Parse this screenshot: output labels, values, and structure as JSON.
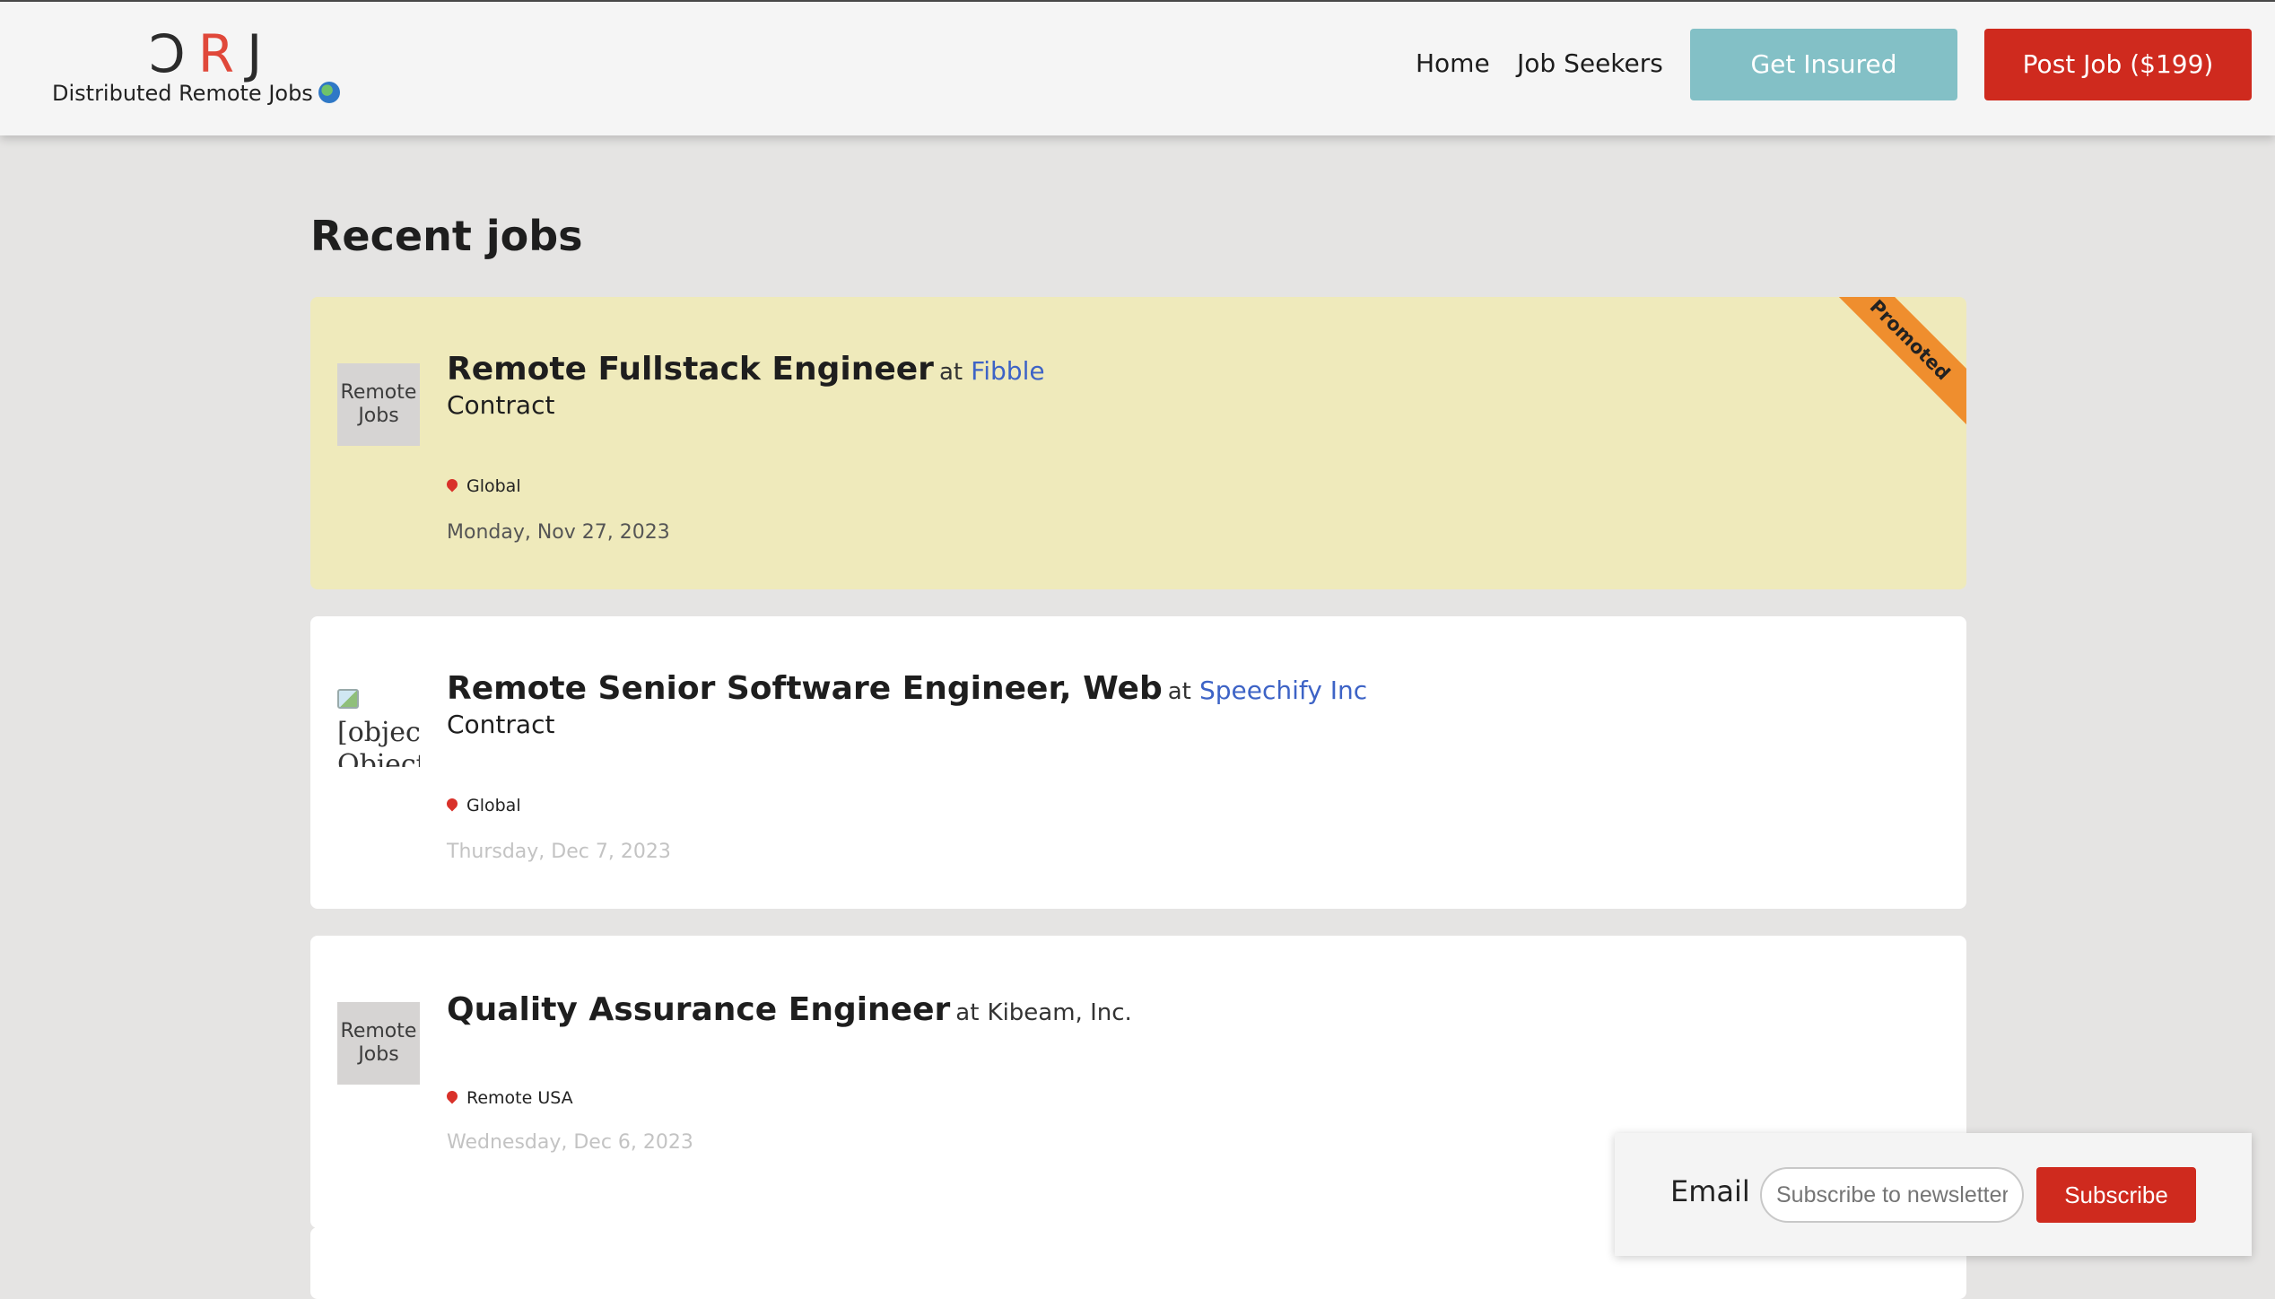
{
  "brand": {
    "logo_left": "Ɔ",
    "logo_mid": "R",
    "logo_right": "J",
    "tagline": "Distributed Remote Jobs"
  },
  "nav": {
    "home": "Home",
    "job_seekers": "Job Seekers",
    "get_insured": "Get Insured",
    "post_job": "Post Job ($199)"
  },
  "page": {
    "heading": "Recent jobs"
  },
  "jobs": [
    {
      "title": "Remote Fullstack Engineer",
      "at": "at",
      "company": "Fibble",
      "type": "Contract",
      "location": "Global",
      "date": "Monday, Nov 27, 2023",
      "badge": "Promoted",
      "thumb": "Remote Jobs"
    },
    {
      "title": "Remote Senior Software Engineer, Web",
      "at": "at",
      "company": "Speechify Inc",
      "type": "Contract",
      "location": "Global",
      "date": "Thursday, Dec 7, 2023",
      "thumb": "[object Object]"
    },
    {
      "title": "Quality Assurance Engineer",
      "at": "at",
      "company": "Kibeam, Inc.",
      "location": "Remote USA",
      "date": "Wednesday, Dec 6, 2023",
      "thumb": "Remote Jobs"
    }
  ],
  "newsletter": {
    "label": "Email",
    "placeholder": "Subscribe to newsletter",
    "button": "Subscribe"
  },
  "colors": {
    "accent_red": "#cf2a1e",
    "teal": "#83c0c6",
    "promoted_bg": "#efeabb",
    "ribbon": "#ef8e2e",
    "link_blue": "#3d63c6"
  }
}
